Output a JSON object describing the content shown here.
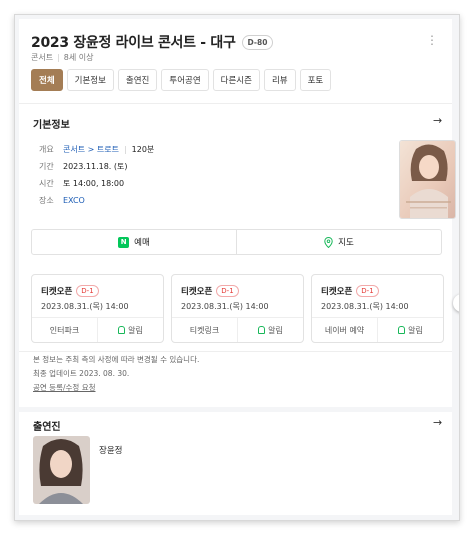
{
  "header": {
    "title": "2023 장윤정 라이브 콘서트 - 대구",
    "dday": "D-80",
    "category": "콘서트",
    "age": "8세 이상"
  },
  "tabs": [
    {
      "label": "전체",
      "active": true
    },
    {
      "label": "기본정보"
    },
    {
      "label": "출연진"
    },
    {
      "label": "투어공연"
    },
    {
      "label": "다른시즌"
    },
    {
      "label": "리뷰"
    },
    {
      "label": "포토"
    }
  ],
  "basic_info": {
    "section_title": "기본정보",
    "rows": {
      "genre_label": "개요",
      "genre": "콘서트 > 트로트",
      "runtime": "120분",
      "period_label": "기간",
      "period": "2023.11.18. (토)",
      "time_label": "시간",
      "time": "토 14:00, 18:00",
      "venue_label": "장소",
      "venue": "EXCO"
    }
  },
  "actions": {
    "reserve_icon": "N",
    "reserve": "예매",
    "map": "지도"
  },
  "tickets": [
    {
      "name": "티켓오픈",
      "dday": "D-1",
      "date": "2023.08.31.(목) 14:00",
      "vendor": "인터파크",
      "alarm": "알림"
    },
    {
      "name": "티켓오픈",
      "dday": "D-1",
      "date": "2023.08.31.(목) 14:00",
      "vendor": "티켓링크",
      "alarm": "알림"
    },
    {
      "name": "티켓오픈",
      "dday": "D-1",
      "date": "2023.08.31.(목) 14:00",
      "vendor": "네이버 예약",
      "alarm": "알림"
    }
  ],
  "notice": {
    "line1": "본 정보는 주최 측의 사정에 따라 변경될 수 있습니다.",
    "line2": "최종 업데이트 2023. 08. 30.",
    "link": "공연 등록/수정 요청"
  },
  "cast": {
    "section_title": "출연진",
    "members": [
      {
        "name": "장윤정"
      }
    ]
  },
  "colors": {
    "accent": "#a47d55",
    "link": "#1d5db5",
    "naver_green": "#03c75a",
    "dday_red": "#e53935"
  }
}
